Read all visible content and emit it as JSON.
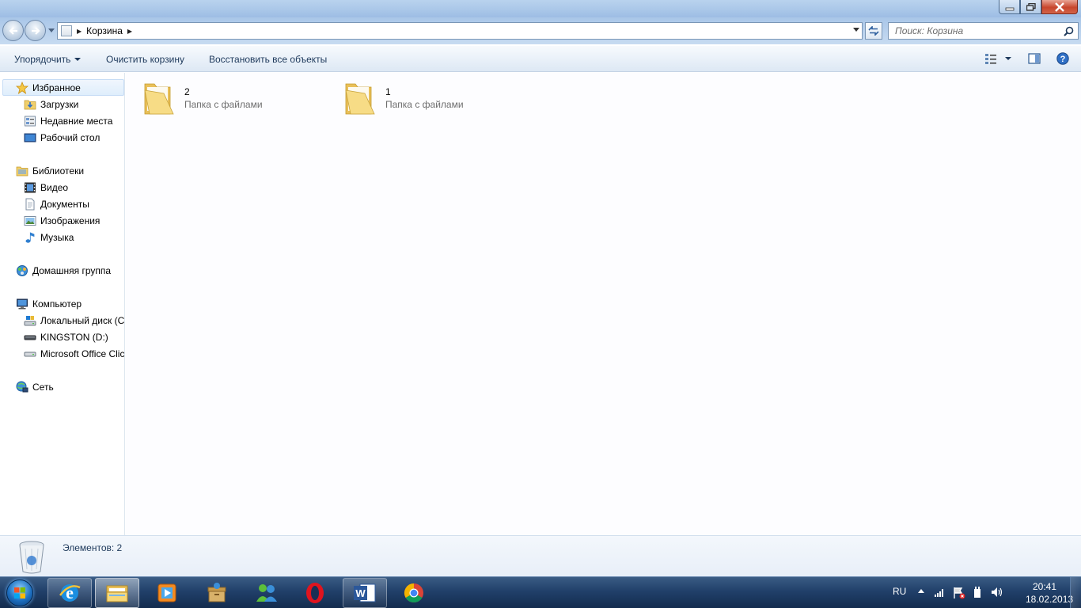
{
  "window": {
    "minimize_label": "Свернуть",
    "maximize_label": "Развернуть",
    "close_label": "Закрыть"
  },
  "address": {
    "crumb": "Корзина",
    "search_placeholder": "Поиск: Корзина"
  },
  "toolbar": {
    "organize": "Упорядочить",
    "empty_bin": "Очистить корзину",
    "restore_all": "Восстановить все объекты"
  },
  "sidebar": {
    "favorites": "Избранное",
    "downloads": "Загрузки",
    "recent": "Недавние места",
    "desktop": "Рабочий стол",
    "libraries": "Библиотеки",
    "video": "Видео",
    "documents": "Документы",
    "pictures": "Изображения",
    "music": "Музыка",
    "homegroup": "Домашняя группа",
    "computer": "Компьютер",
    "local_disk": "Локальный диск (C:)",
    "kingston": "KINGSTON (D:)",
    "office": "Microsoft Office Click-to-Run",
    "network": "Сеть"
  },
  "items": [
    {
      "name": "2",
      "type": "Папка с файлами"
    },
    {
      "name": "1",
      "type": "Папка с файлами"
    }
  ],
  "details": {
    "count": "Элементов: 2"
  },
  "taskbar": {
    "lang": "RU",
    "time": "20:41",
    "date": "18.02.2013"
  },
  "colors": {
    "folder_yellow": "#f2d37a",
    "taskbar_dark": "#132c4e",
    "link_blue": "#1e395b"
  }
}
